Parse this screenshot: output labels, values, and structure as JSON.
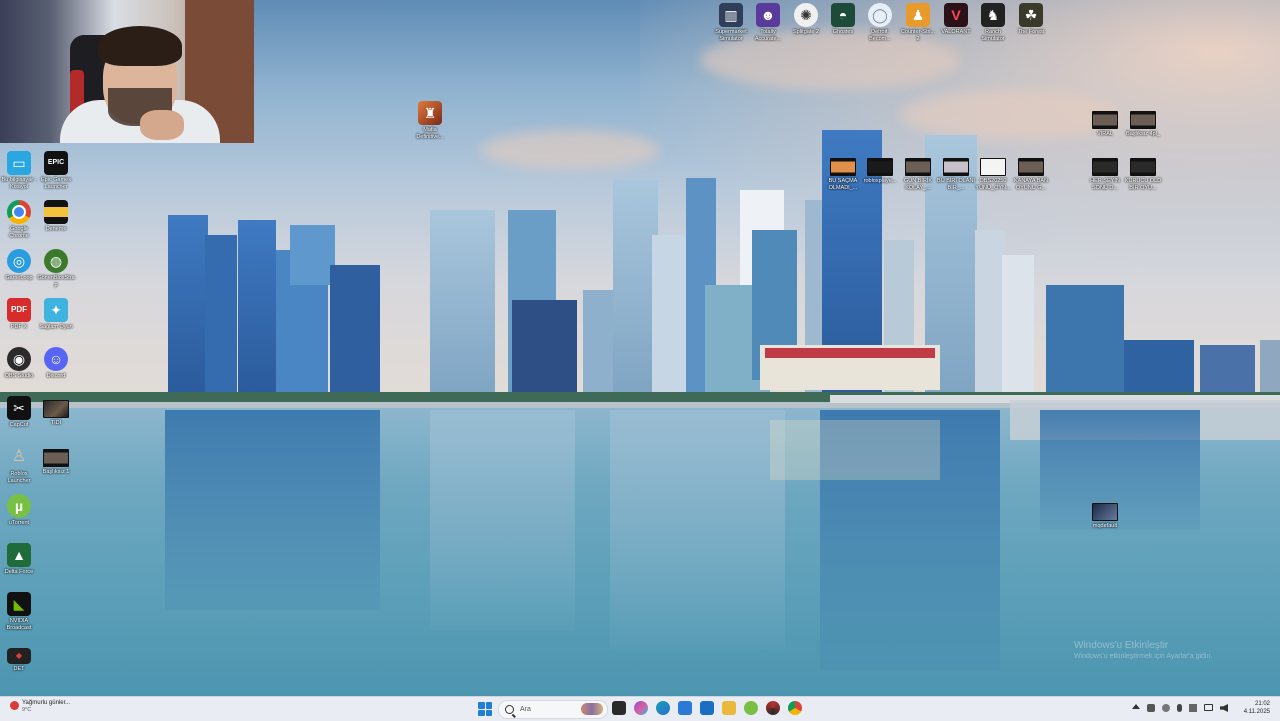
{
  "desktop": {
    "left_icons": [
      {
        "label": "Bu bilgisayar - Kısayol",
        "icon": "pc-icon",
        "color": "#2aa7e0"
      },
      {
        "label": "Epic Games Launcher",
        "icon": "epic-games-icon",
        "color": "#111111"
      },
      {
        "label": "Google Chrome",
        "icon": "chrome-icon",
        "color": "#db4437"
      },
      {
        "label": "Deneme",
        "icon": "folder-icon",
        "color": "#f2c23a"
      },
      {
        "label": "GameLoop",
        "icon": "gameloop-icon",
        "color": "#2a9de0"
      },
      {
        "label": "GönenBloxStrap",
        "icon": "globe-icon",
        "color": "#3b7a2a"
      },
      {
        "label": "PDF X",
        "icon": "pdf-icon",
        "color": "#d62c2c"
      },
      {
        "label": "Sağlam Oyun",
        "icon": "game-icon",
        "color": "#3fb3e0"
      },
      {
        "label": "OBS Studio",
        "icon": "obs-icon",
        "color": "#2b2b2b"
      },
      {
        "label": "Discord",
        "icon": "discord-icon",
        "color": "#5865f2"
      },
      {
        "label": "CapCut",
        "icon": "capcut-icon",
        "color": "#111111"
      },
      {
        "label": "TIDI",
        "icon": "image-file-icon",
        "color": "#6b5a4a"
      },
      {
        "label": "Roblox Launcher",
        "icon": "roblox-icon",
        "color": "#6a7fb8"
      },
      {
        "label": "Başlıksız 1",
        "icon": "video-file-icon",
        "color": "#333333"
      },
      {
        "label": "uTorrent",
        "icon": "utorrent-icon",
        "color": "#78c043"
      },
      {
        "label": "Delta Force",
        "icon": "delta-force-icon",
        "color": "#1f6b3a"
      },
      {
        "label": "NVIDIA Broadcast",
        "icon": "nvidia-icon",
        "color": "#76b900"
      },
      {
        "label": "DET",
        "icon": "det-icon",
        "color": "#222222"
      }
    ],
    "top_icons": [
      {
        "label": "Supermarket Simulator",
        "icon": "supermarket-icon",
        "color": "#2f3f5a"
      },
      {
        "label": "Totally Accurate...",
        "icon": "tabs-icon",
        "color": "#5a3a9a"
      },
      {
        "label": "Splitgate 2",
        "icon": "splitgate-icon",
        "color": "#f0f0f0"
      },
      {
        "label": "Ghostes",
        "icon": "ghost-icon",
        "color": "#1e4a3a"
      },
      {
        "label": "Detroit: Becom...",
        "icon": "detroit-icon",
        "color": "#e8eef6"
      },
      {
        "label": "Counter-Stri... 2",
        "icon": "counter-strike-icon",
        "color": "#e89a2a"
      },
      {
        "label": "VALORANT",
        "icon": "valorant-icon",
        "color": "#2a1218"
      },
      {
        "label": "Ranch Simulator",
        "icon": "ranch-icon",
        "color": "#222222"
      },
      {
        "label": "The Forest",
        "icon": "forest-icon",
        "color": "#3a3a2a"
      }
    ],
    "mid_icons": [
      {
        "label": "Mafia Definitive...",
        "icon": "mafia-icon",
        "color": "#b8502a"
      }
    ],
    "video_row": [
      {
        "label": "BU SAÇMA OLMADI_...",
        "icon": "video-file-icon"
      },
      {
        "label": "robloxplaye...",
        "icon": "video-file-icon"
      },
      {
        "label": "GÜN BİRİK KOLAY_...",
        "icon": "video-file-icon"
      },
      {
        "label": "BÜ BİRİ OLANI BİR_...",
        "icon": "video-file-icon"
      },
      {
        "label": "OBS20250 YÜNÜ_OYN...",
        "icon": "video-file-icon"
      },
      {
        "label": "KANAYA BAN OYUNU G...",
        "icon": "video-file-icon"
      }
    ],
    "right_icons": [
      {
        "label": "VİRAL",
        "icon": "video-file-icon"
      },
      {
        "label": "Başlıksız 4pl_",
        "icon": "video-file-icon"
      },
      {
        "label": "HER ŞEYİN SONU D...",
        "icon": "video-file-icon"
      },
      {
        "label": "KURUCU OLD BİR OYU...",
        "icon": "video-file-icon"
      },
      {
        "label": "mqdefault",
        "icon": "image-file-icon"
      }
    ],
    "watermark": {
      "title": "Windows'u Etkinleştir",
      "subtitle": "Windows'u etkinleştirmek için Ayarlar'a gidin."
    }
  },
  "taskbar": {
    "weather_title": "Yağmurlu günler...",
    "weather_temp": "9°C",
    "search_placeholder": "Ara",
    "apps": [
      {
        "name": "file-explorer-icon",
        "color": "#f0c24a"
      },
      {
        "name": "copilot-icon",
        "color": "#7a5ae0"
      },
      {
        "name": "edge-icon",
        "color": "#1aa0b0"
      },
      {
        "name": "store-icon",
        "color": "#2a7ad6"
      },
      {
        "name": "outlook-icon",
        "color": "#1a6fc4"
      },
      {
        "name": "folder-icon",
        "color": "#e8b93a"
      },
      {
        "name": "utorrent-icon",
        "color": "#78c043"
      },
      {
        "name": "davinci-icon",
        "color": "#c03030"
      },
      {
        "name": "chrome-icon",
        "color": "#db4437"
      }
    ],
    "time": "21:02",
    "date": "4.11.2025"
  }
}
